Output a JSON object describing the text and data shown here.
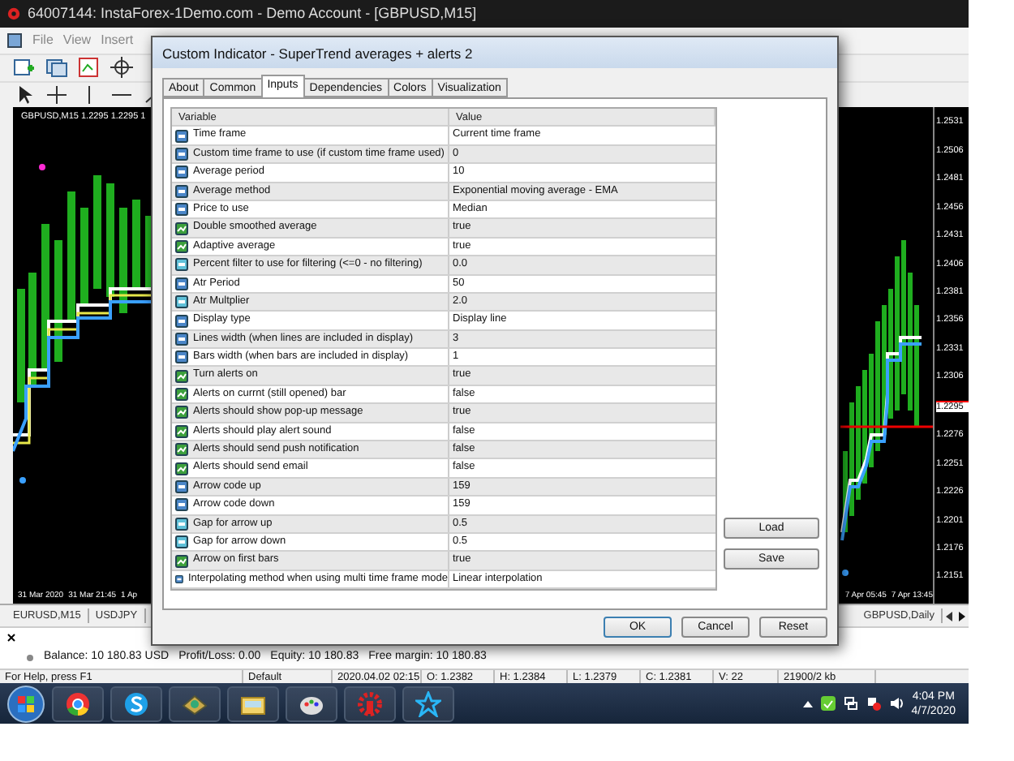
{
  "window": {
    "title": "64007144: InstaForex-1Demo.com - Demo Account - [GBPUSD,M15]"
  },
  "menu": [
    "File",
    "View",
    "Insert"
  ],
  "chart": {
    "header": "GBPUSD,M15  1.2295 1.2295 1",
    "left_times": [
      "31 Mar 2020",
      "31 Mar 21:45",
      "1 Ap"
    ],
    "right_times": [
      "7 Apr 05:45",
      "7 Apr 13:45"
    ],
    "prices": [
      {
        "text": "1.2531",
        "current": false
      },
      {
        "text": "1.2506",
        "current": false
      },
      {
        "text": "1.2481",
        "current": false
      },
      {
        "text": "1.2456",
        "current": false
      },
      {
        "text": "1.2431",
        "current": false
      },
      {
        "text": "1.2406",
        "current": false
      },
      {
        "text": "1.2381",
        "current": false
      },
      {
        "text": "1.2356",
        "current": false
      },
      {
        "text": "1.2331",
        "current": false
      },
      {
        "text": "1.2306",
        "current": false
      },
      {
        "text": "1.2295",
        "current": true
      },
      {
        "text": "1.2276",
        "current": false
      },
      {
        "text": "1.2251",
        "current": false
      },
      {
        "text": "1.2226",
        "current": false
      },
      {
        "text": "1.2201",
        "current": false
      },
      {
        "text": "1.2176",
        "current": false
      },
      {
        "text": "1.2151",
        "current": false
      }
    ]
  },
  "chart_tabs": {
    "left": [
      "EURUSD,M15",
      "USDJPY"
    ],
    "right": "GBPUSD,Daily"
  },
  "terminal": [
    "Balance: 10 180.83 USD",
    "Profit/Loss: 0.00",
    "Equity: 10 180.83",
    "Free margin: 10 180.83"
  ],
  "status_bar": [
    "For Help, press F1",
    "Default",
    "2020.04.02 02:15",
    "O: 1.2382",
    "H: 1.2384",
    "L: 1.2379",
    "C: 1.2381",
    "V: 22",
    "21900/2 kb"
  ],
  "taskbar": {
    "time": "4:04 PM",
    "date": "4/7/2020"
  },
  "dialog": {
    "title": "Custom Indicator - SuperTrend averages + alerts 2",
    "tabs": [
      {
        "label": "About",
        "selected": false
      },
      {
        "label": "Common",
        "selected": false
      },
      {
        "label": "Inputs",
        "selected": true
      },
      {
        "label": "Dependencies",
        "selected": false
      },
      {
        "label": "Colors",
        "selected": false
      },
      {
        "label": "Visualization",
        "selected": false
      }
    ],
    "columns": [
      "Variable",
      "Value"
    ],
    "rows": [
      {
        "kind": "int",
        "name": "Time frame",
        "value": "Current time frame"
      },
      {
        "kind": "int",
        "name": "Custom time frame to use (if custom time frame used)",
        "value": "0"
      },
      {
        "kind": "int",
        "name": "Average period",
        "value": "10"
      },
      {
        "kind": "int",
        "name": "Average method",
        "value": "Exponential moving average - EMA"
      },
      {
        "kind": "int",
        "name": "Price to use",
        "value": "Median"
      },
      {
        "kind": "bool",
        "name": "Double smoothed average",
        "value": "true"
      },
      {
        "kind": "bool",
        "name": "Adaptive average",
        "value": "true"
      },
      {
        "kind": "double",
        "name": "Percent filter to use for filtering (<=0 - no filtering)",
        "value": "0.0"
      },
      {
        "kind": "int",
        "name": "Atr Period",
        "value": "50"
      },
      {
        "kind": "double",
        "name": "Atr Multplier",
        "value": "2.0"
      },
      {
        "kind": "int",
        "name": "Display type",
        "value": "Display line"
      },
      {
        "kind": "int",
        "name": "Lines width (when lines are included in display)",
        "value": "3"
      },
      {
        "kind": "int",
        "name": "Bars width (when bars are included in display)",
        "value": "1"
      },
      {
        "kind": "bool",
        "name": "Turn alerts on",
        "value": "true"
      },
      {
        "kind": "bool",
        "name": "Alerts on currnt (still opened) bar",
        "value": "false"
      },
      {
        "kind": "bool",
        "name": "Alerts should show pop-up message",
        "value": "true"
      },
      {
        "kind": "bool",
        "name": "Alerts should play alert sound",
        "value": "false"
      },
      {
        "kind": "bool",
        "name": "Alerts should send push notification",
        "value": "false"
      },
      {
        "kind": "bool",
        "name": "Alerts should send email",
        "value": "false"
      },
      {
        "kind": "int",
        "name": "Arrow code up",
        "value": "159"
      },
      {
        "kind": "int",
        "name": "Arrow code down",
        "value": "159"
      },
      {
        "kind": "double",
        "name": "Gap for arrow up",
        "value": "0.5"
      },
      {
        "kind": "double",
        "name": "Gap for arrow down",
        "value": "0.5"
      },
      {
        "kind": "bool",
        "name": "Arrow on first bars",
        "value": "true"
      },
      {
        "kind": "int",
        "name": "Interpolating method when using multi time frame mode",
        "value": "Linear interpolation"
      }
    ],
    "side_buttons": [
      "Load",
      "Save"
    ],
    "buttons": [
      "OK",
      "Cancel",
      "Reset"
    ]
  }
}
